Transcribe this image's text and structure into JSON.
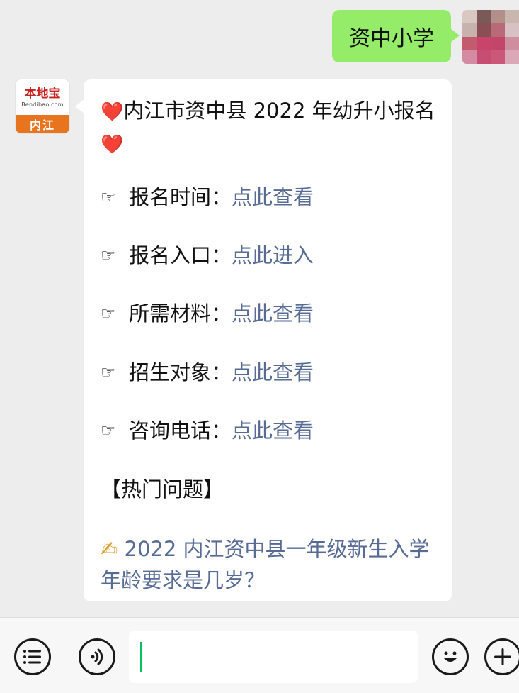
{
  "user_message": {
    "text": "资中小学",
    "avatar_colors": [
      "#d9c8c2",
      "#7a5a58",
      "#b28f88",
      "#c9b6ae",
      "#c7b2ad",
      "#8a4e55",
      "#b86a78",
      "#d8c1c4",
      "#c35a6e",
      "#c9446a",
      "#c4456a",
      "#cf8ea0",
      "#d48aa2",
      "#c84d73",
      "#cb5779",
      "#dba8b8"
    ]
  },
  "bot": {
    "avatar": {
      "brand": "本地宝",
      "domain": "Bendibao.com",
      "city": "内江"
    },
    "title_prefix": "❤️",
    "title": "内江市资中县 2022 年幼升小报名",
    "title_suffix": "❤️",
    "hand_icon": "☞",
    "items": [
      {
        "label": "报名时间：",
        "link": "点此查看"
      },
      {
        "label": "报名入口：",
        "link": "点此进入"
      },
      {
        "label": "所需材料：",
        "link": "点此查看"
      },
      {
        "label": "招生对象：",
        "link": "点此查看"
      },
      {
        "label": "咨询电话：",
        "link": "点此查看"
      }
    ],
    "section_title": "【热门问题】",
    "question_icon": "✍",
    "question": "2022 内江资中县一年级新生入学年龄要求是几岁？"
  },
  "input_bar": {
    "icons": [
      "list-icon",
      "voice-icon",
      "emoji-icon",
      "plus-icon"
    ],
    "accent": "#07c160"
  }
}
